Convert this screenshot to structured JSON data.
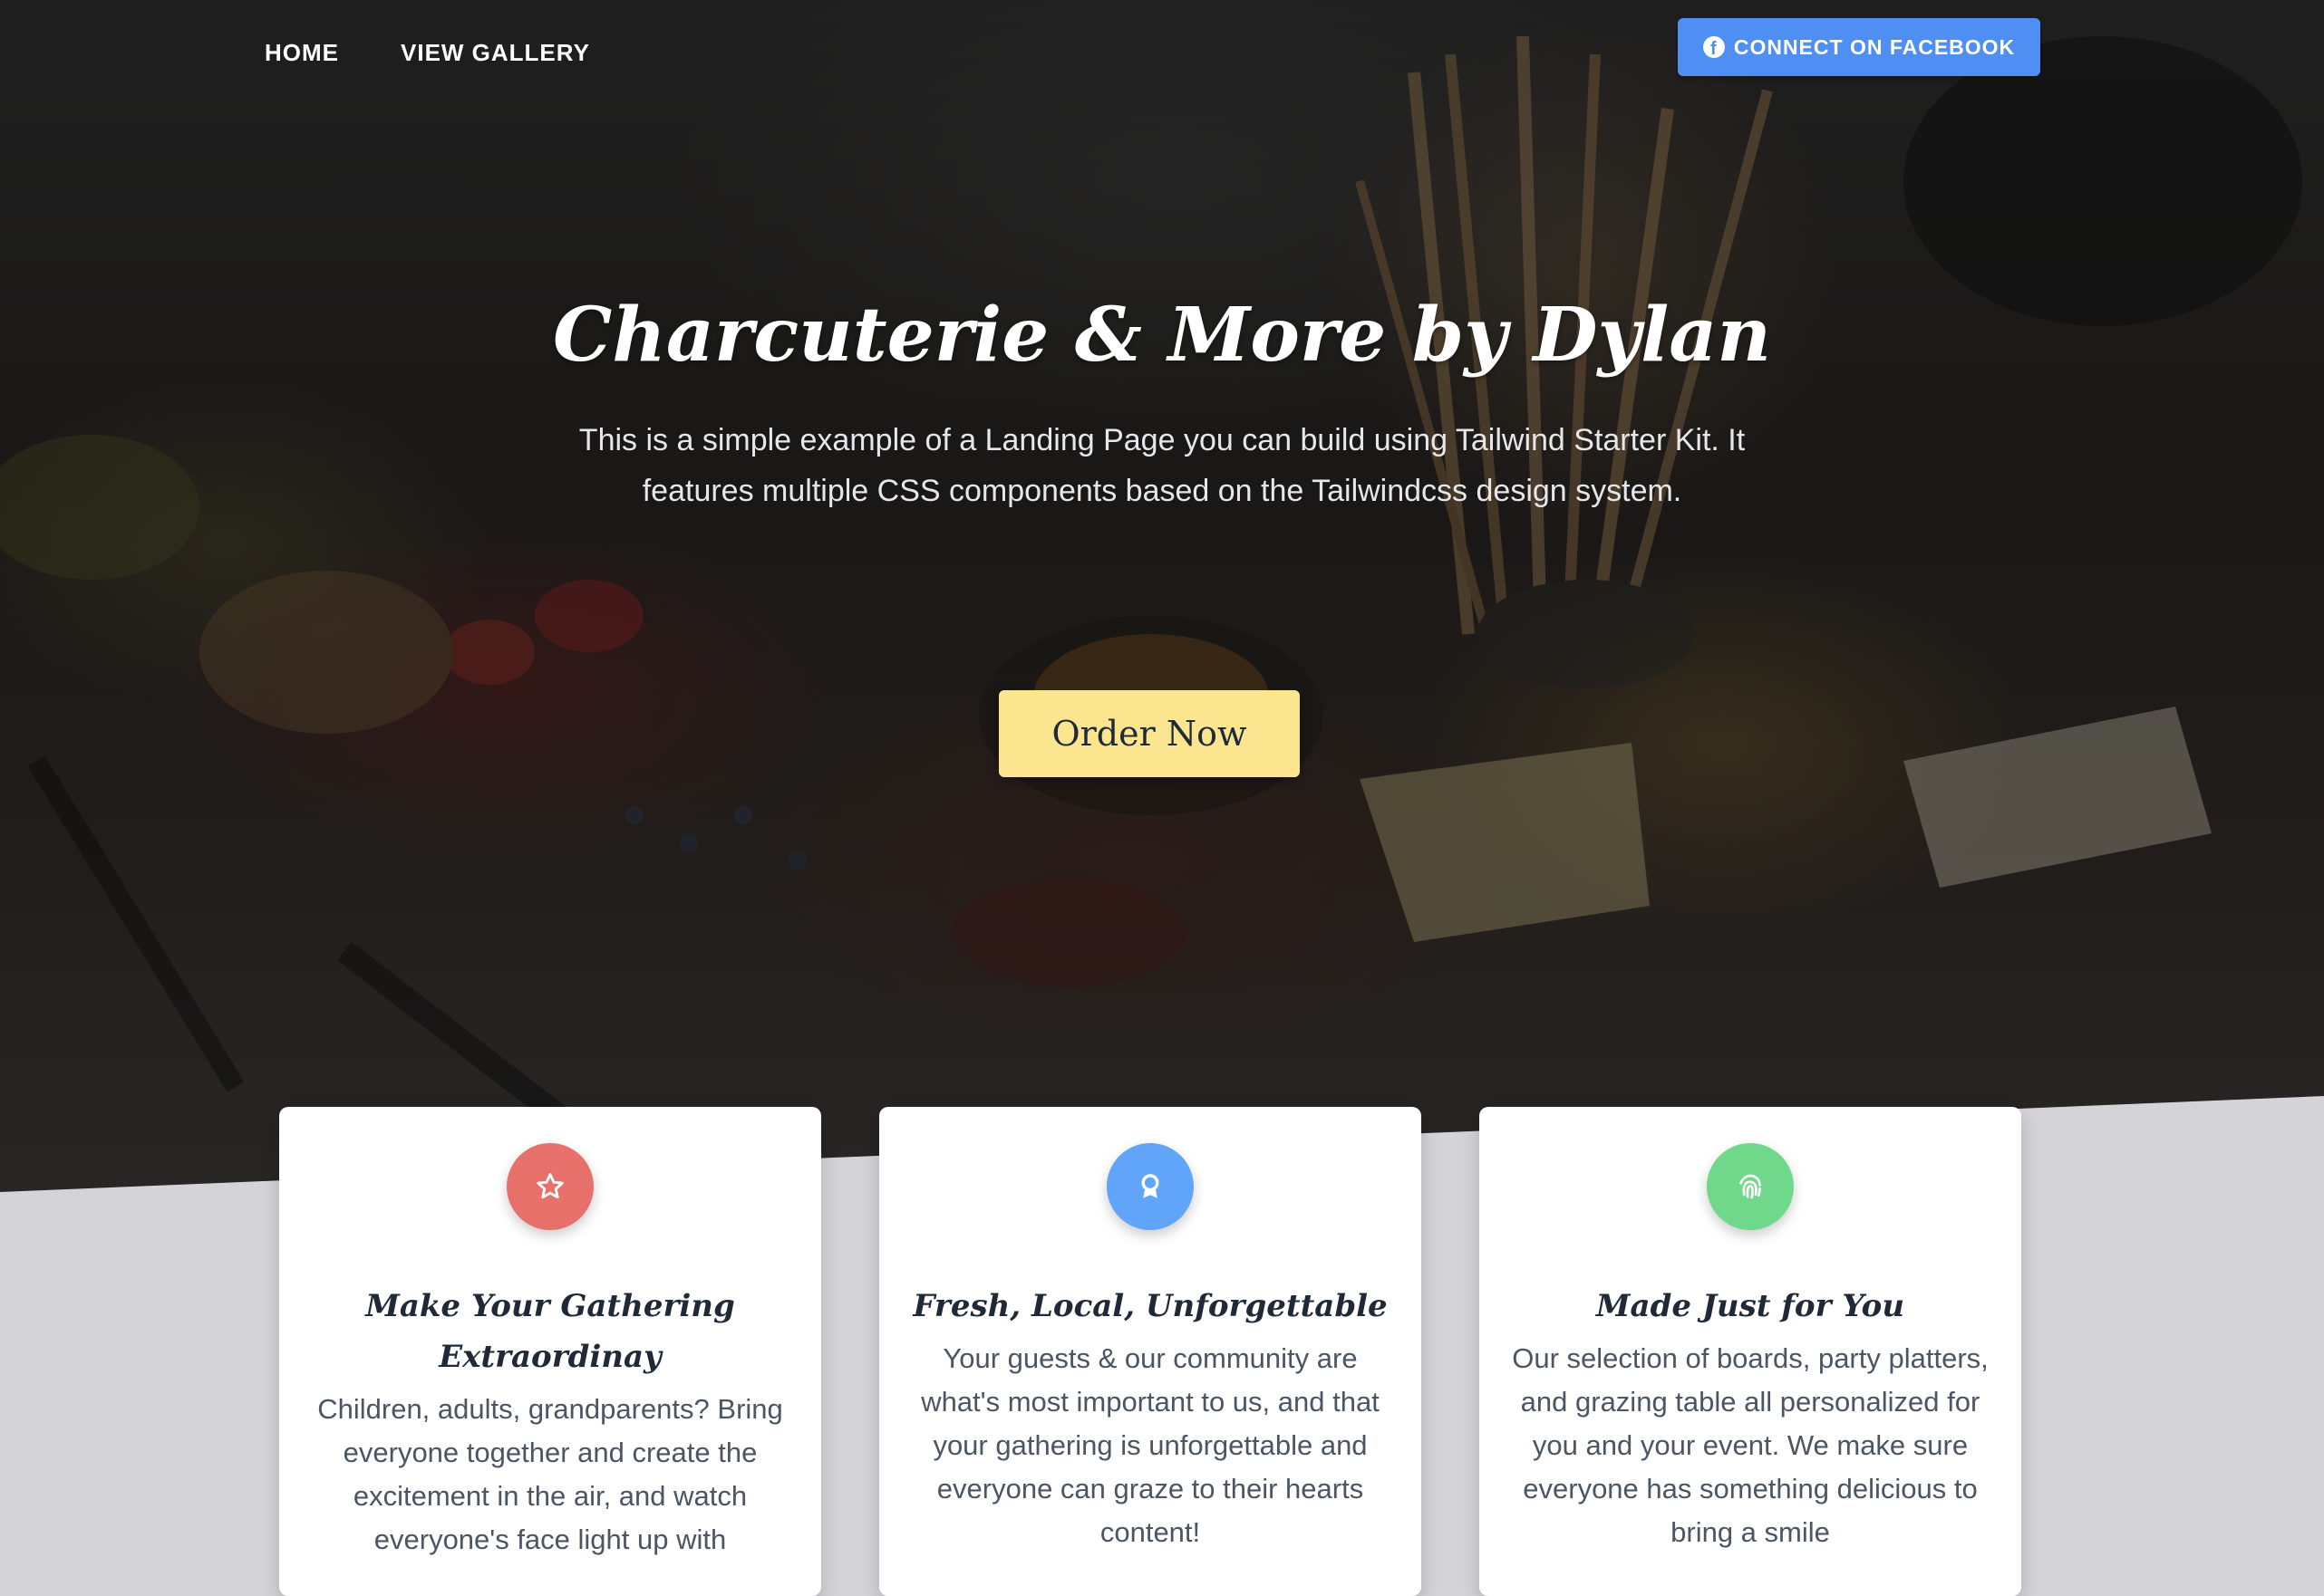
{
  "nav": {
    "home_label": "HOME",
    "gallery_label": "VIEW GALLERY",
    "facebook_label": "CONNECT ON FACEBOOK",
    "facebook_icon": "facebook-icon"
  },
  "hero": {
    "title": "Charcuterie & More by Dylan",
    "description": "This is a simple example of a Landing Page you can build using Tailwind Starter Kit. It features multiple CSS components based on the Tailwindcss design system.",
    "cta_label": "Order Now",
    "cta_color": "#fce58f"
  },
  "features": [
    {
      "icon": "star-icon",
      "color": "#e8706b",
      "title": "Make Your Gathering Extraordinay",
      "text": "Children, adults, grandparents? Bring everyone together and create the excitement in the air, and watch everyone's face light up with"
    },
    {
      "icon": "award-icon",
      "color": "#60a5fa",
      "title": "Fresh, Local, Unforgettable",
      "text": "Your guests & our community are what's most important to us, and that your gathering is unforgettable and everyone can graze to their hearts content!"
    },
    {
      "icon": "fingerprint-icon",
      "color": "#6fd88a",
      "title": "Made Just for You",
      "text": "Our selection of boards, party platters, and grazing table all personalized for you and your event. We make sure everyone has something delicious to bring a smile"
    }
  ]
}
